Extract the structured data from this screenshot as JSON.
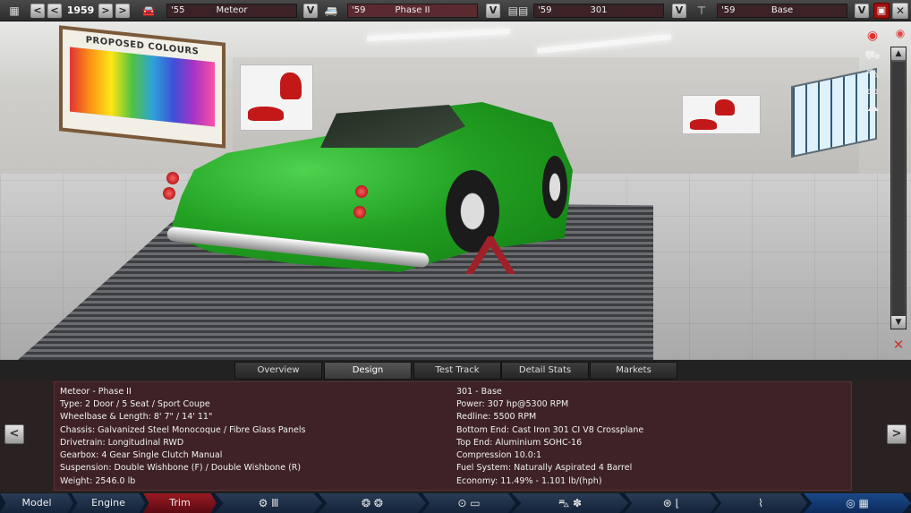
{
  "topbar": {
    "year": "1959",
    "model": {
      "year": "'55",
      "name": "Meteor"
    },
    "trim": {
      "year": "'59",
      "name": "Phase II"
    },
    "engine": {
      "year": "'59",
      "name": "301"
    },
    "variant": {
      "year": "'59",
      "name": "Base"
    },
    "dropdown_glyph": "V",
    "prev_glyph": "<",
    "next_glyph": ">",
    "first_glyph": "<",
    "last_glyph": ">"
  },
  "scene": {
    "board_title": "PROPOSED COLOURS",
    "car_color": "#22a022"
  },
  "tabs": [
    {
      "label": "Overview"
    },
    {
      "label": "Design"
    },
    {
      "label": "Test Track"
    },
    {
      "label": "Detail Stats"
    },
    {
      "label": "Markets"
    }
  ],
  "active_tab": "Design",
  "info": {
    "left": [
      "Meteor - Phase II",
      "Type: 2 Door / 5 Seat / Sport Coupe",
      "Wheelbase & Length: 8' 7\" / 14' 11\"",
      "Chassis: Galvanized Steel Monocoque / Fibre Glass Panels",
      "Drivetrain: Longitudinal RWD",
      "Gearbox: 4 Gear Single Clutch Manual",
      "Suspension: Double Wishbone (F) / Double Wishbone (R)",
      "Weight: 2546.0 lb"
    ],
    "right": [
      "301 - Base",
      "Power: 307 hp@5300 RPM",
      "Redline: 5500 RPM",
      "Bottom End: Cast Iron 301 CI V8 Crossplane",
      "Top End: Aluminium SOHC-16",
      "Compression 10.0:1",
      "Fuel System: Naturally Aspirated 4 Barrel",
      "Economy: 11.49% - 1.101 lb/(hph)"
    ]
  },
  "nav": {
    "model": "Model",
    "engine": "Engine",
    "trim": "Trim"
  },
  "colors": {
    "panel_bg": "#3e2226",
    "trim_nav": "#9a1a22",
    "nav_bg": "#0c1a2e"
  }
}
